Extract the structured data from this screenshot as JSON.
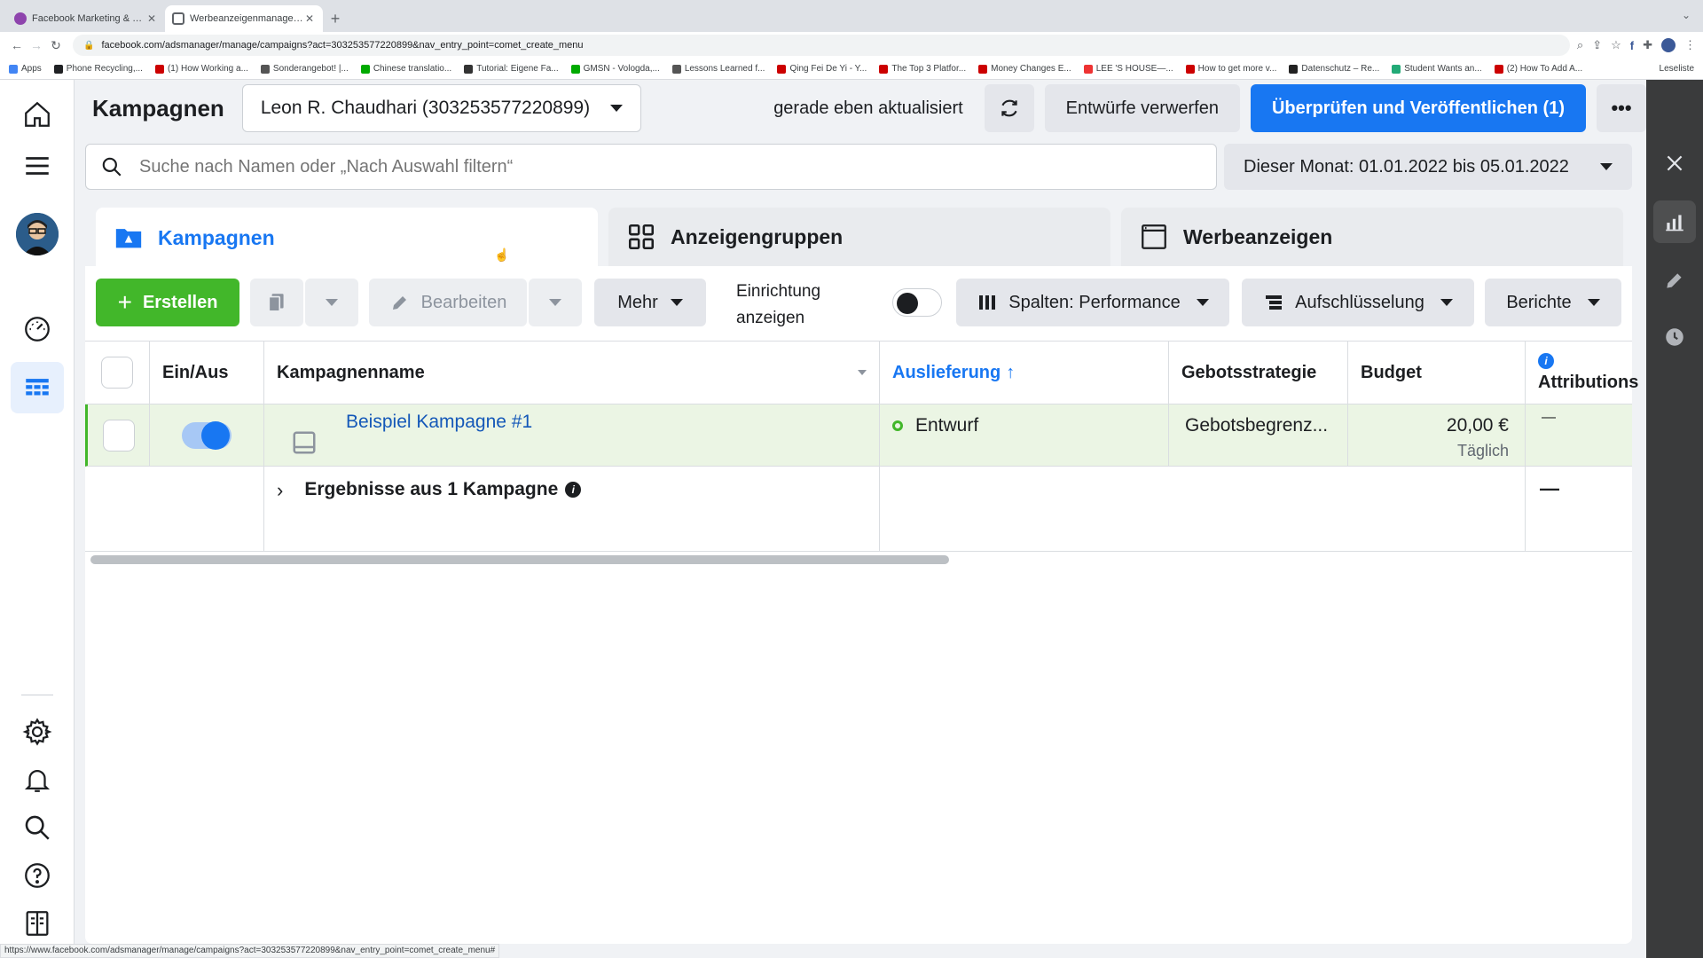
{
  "browser": {
    "tabs": [
      {
        "title": "Facebook Marketing & Werbea",
        "active": false,
        "color": "#8e44ad"
      },
      {
        "title": "Werbeanzeigenmanager - Wer",
        "active": true,
        "color": "#5f6368"
      }
    ],
    "new_tab": "+",
    "url": "facebook.com/adsmanager/manage/campaigns?act=303253577220899&nav_entry_point=comet_create_menu",
    "bookmarks": [
      "Apps",
      "Phone Recycling,...",
      "(1) How Working a...",
      "Sonderangebot! |...",
      "Chinese translatio...",
      "Tutorial: Eigene Fa...",
      "GMSN - Vologda,...",
      "Lessons Learned f...",
      "Qing Fei De Yi - Y...",
      "The Top 3 Platfor...",
      "Money Changes E...",
      "LEE 'S HOUSE—...",
      "How to get more v...",
      "Datenschutz – Re...",
      "Student Wants an...",
      "(2) How To Add A..."
    ],
    "reading_list": "Leseliste",
    "status_url": "https://www.facebook.com/adsmanager/manage/campaigns?act=303253577220899&nav_entry_point=comet_create_menu#"
  },
  "header": {
    "title": "Kampagnen",
    "account": "Leon R. Chaudhari (303253577220899)",
    "updated": "gerade eben aktualisiert",
    "discard": "Entwürfe verwerfen",
    "publish": "Überprüfen und Veröffentlichen (1)",
    "more": "•••"
  },
  "search": {
    "placeholder": "Suche nach Namen oder „Nach Auswahl filtern“"
  },
  "daterange": "Dieser Monat: 01.01.2022 bis 05.01.2022",
  "level_tabs": [
    "Kampagnen",
    "Anzeigengruppen",
    "Werbeanzeigen"
  ],
  "toolbar": {
    "create": "Erstellen",
    "edit": "Bearbeiten",
    "more": "Mehr",
    "setup_line1": "Einrichtung",
    "setup_line2": "anzeigen",
    "columns": "Spalten: Performance",
    "breakdown": "Aufschlüsselung",
    "reports": "Berichte"
  },
  "table": {
    "headers": {
      "onoff": "Ein/Aus",
      "name": "Kampagnenname",
      "delivery": "Auslieferung",
      "bid": "Gebotsstrategie",
      "budget": "Budget",
      "attribution": "Attributions"
    },
    "rows": [
      {
        "name": "Beispiel Kampagne #1",
        "delivery": "Entwurf",
        "bid": "Gebotsbegrenz...",
        "budget": "20,00 €",
        "budget_type": "Täglich",
        "attribution": "—"
      }
    ],
    "summary": {
      "label": "Ergebnisse aus 1 Kampagne",
      "attribution": "—"
    }
  },
  "colors": {
    "primary": "#1877f2",
    "green": "#42b72a",
    "row_highlight": "#ebf5e4"
  }
}
